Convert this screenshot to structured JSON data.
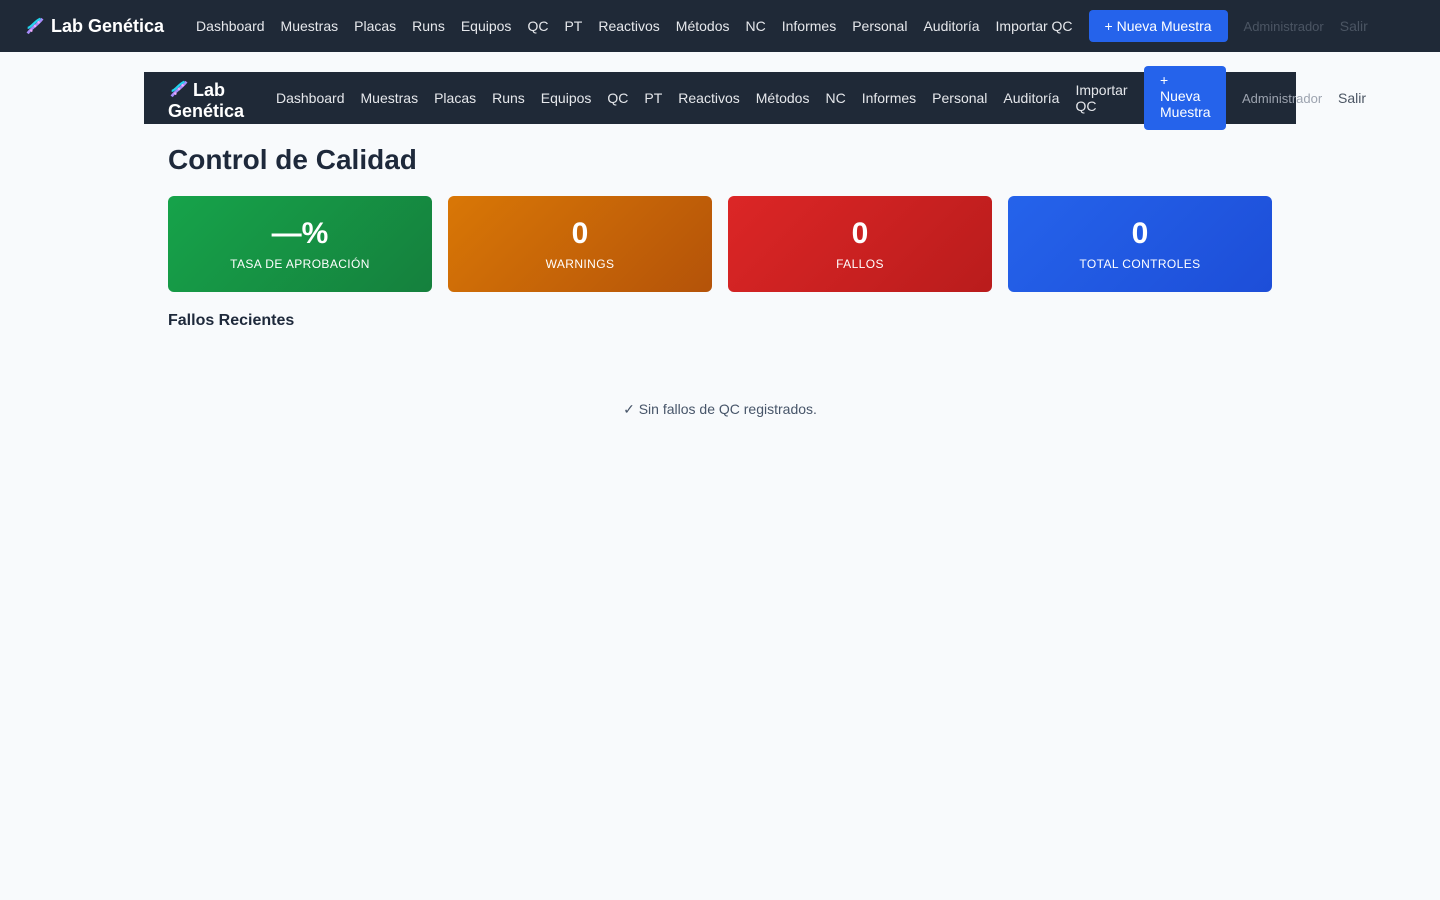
{
  "app": {
    "brand": "Lab Genética"
  },
  "nav": {
    "items": [
      "Dashboard",
      "Muestras",
      "Placas",
      "Runs",
      "Equipos",
      "QC",
      "PT",
      "Reactivos",
      "Métodos",
      "NC",
      "Informes",
      "Personal",
      "Auditoría",
      "Importar QC"
    ],
    "new_sample": "+ Nueva Muestra",
    "user": "Administrador",
    "logout": "Salir"
  },
  "page": {
    "title": "Control de Calidad"
  },
  "stats": [
    {
      "value": "—%",
      "label": "Tasa de Aprobación",
      "color": "#16a34a"
    },
    {
      "value": "0",
      "label": "Warnings",
      "color": "#d97706"
    },
    {
      "value": "0",
      "label": "Fallos",
      "color": "#dc2626"
    },
    {
      "value": "0",
      "label": "Total Controles",
      "color": "#2563eb"
    }
  ],
  "recent_failures": {
    "title": "Fallos Recientes",
    "empty_message": "✓ Sin fallos de QC registrados."
  }
}
